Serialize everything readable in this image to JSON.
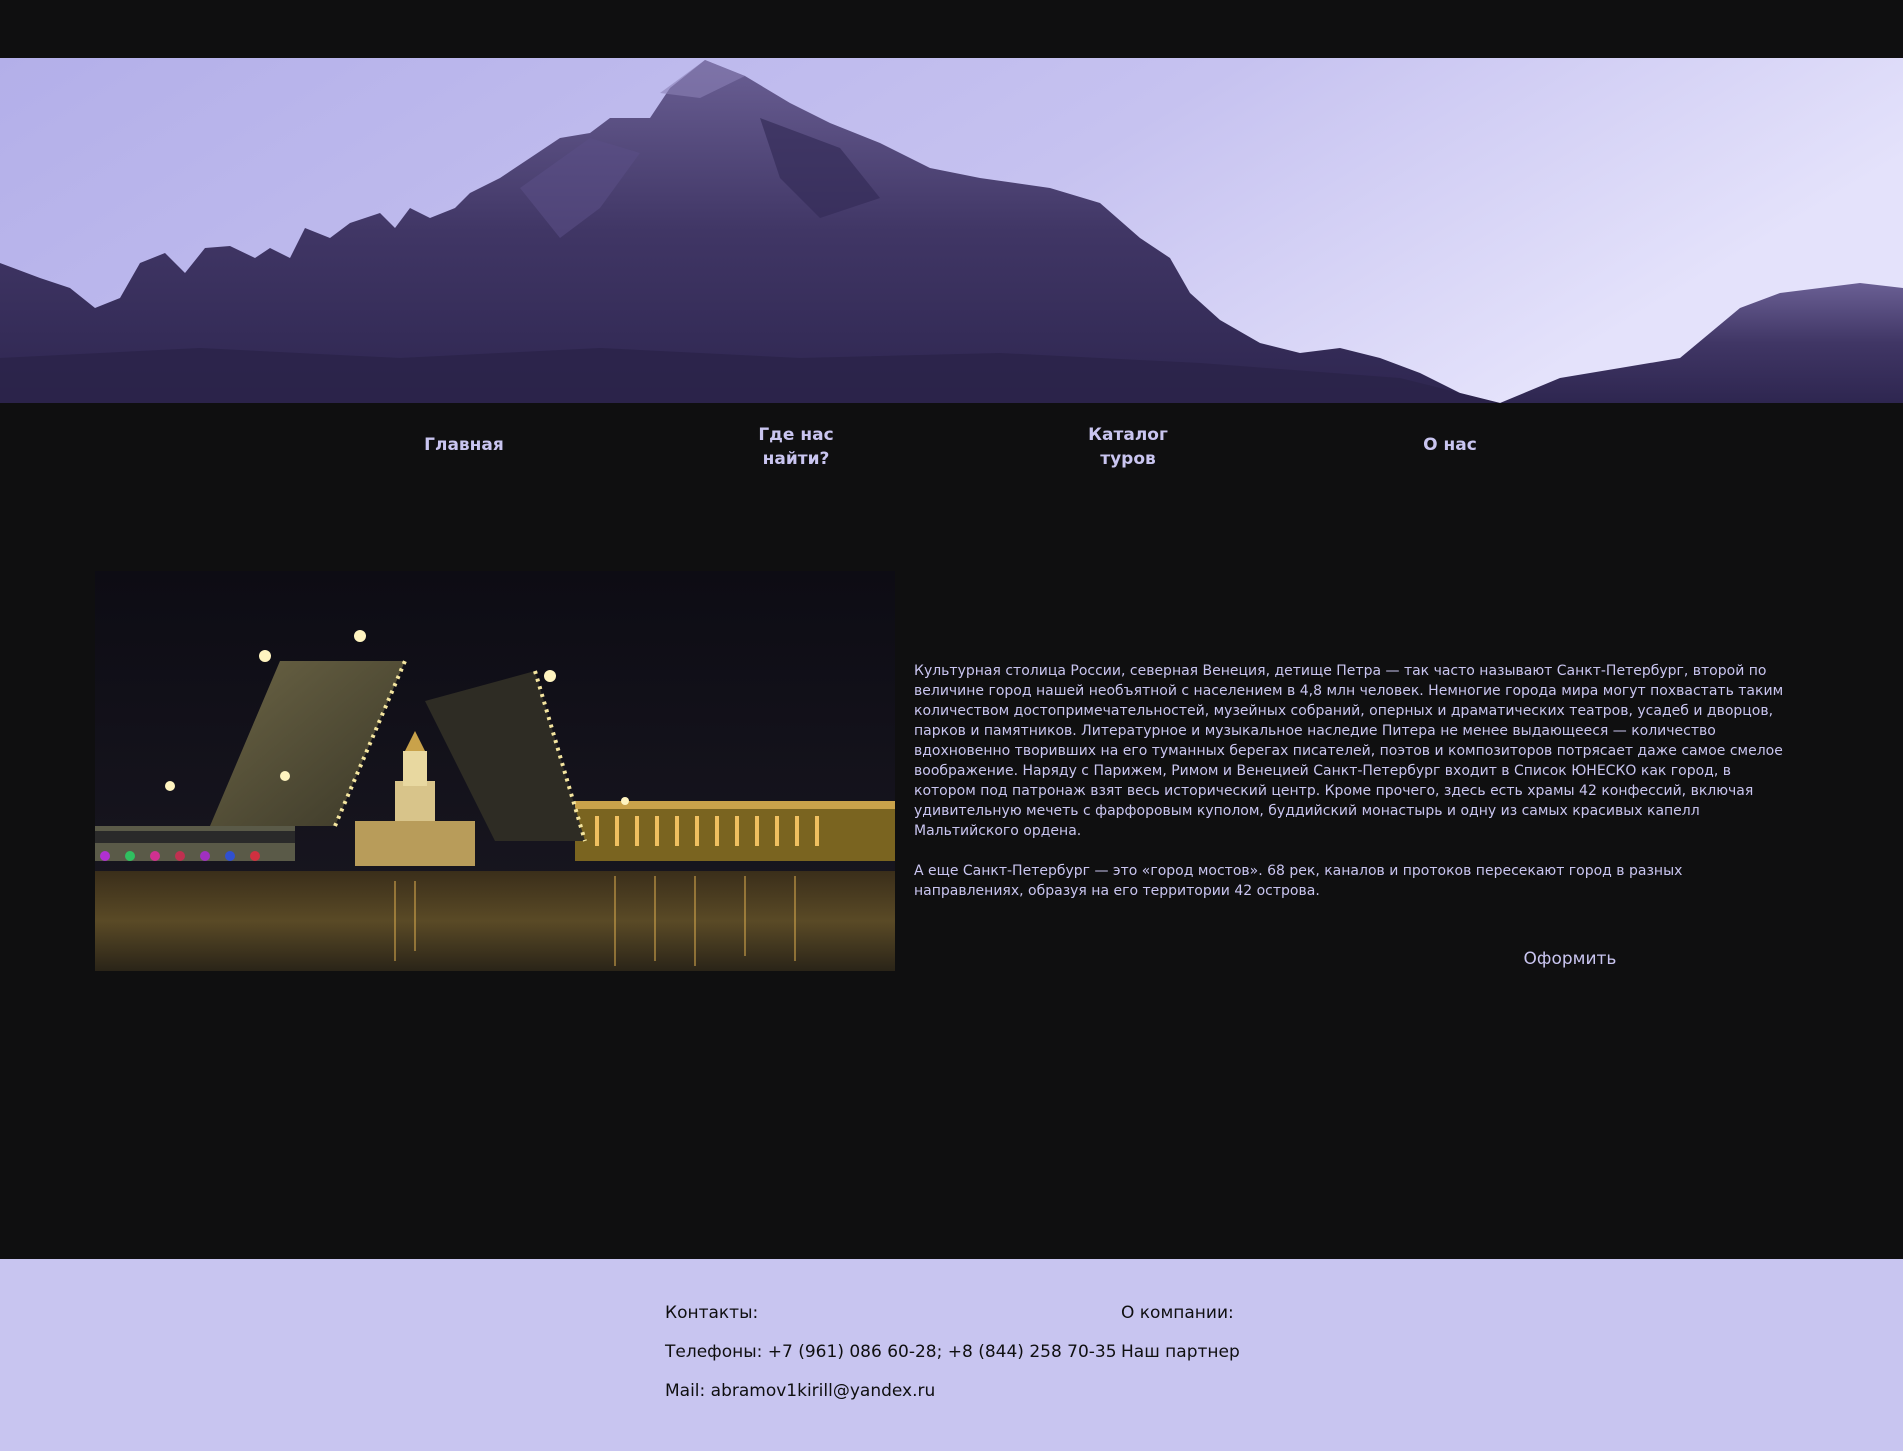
{
  "colors": {
    "background": "#0f0f10",
    "accent": "#c9c5f0",
    "footer_bg": "#c8c5f0",
    "footer_text": "#0f0f10"
  },
  "hero": {
    "image": "mountain-panorama"
  },
  "nav": {
    "items": [
      {
        "label": "Главная"
      },
      {
        "label": "Где нас\nнайти?"
      },
      {
        "label": "Каталог\nтуров"
      },
      {
        "label": "О нас"
      }
    ]
  },
  "main": {
    "image": "night-drawbridge-st-petersburg",
    "paragraphs": [
      "Культурная столица России, северная Венеция, детище Петра — так часто называют Санкт-Петербург, второй по величине город нашей необъятной с населением в 4,8 млн человек. Немногие города мира могут похвастать таким количеством достопримечательностей, музейных собраний, оперных и драматических театров, усадеб и дворцов, парков и памятников. Литературное и музыкальное наследие Питера не менее выдающееся — количество вдохновенно творивших на его туманных берегах писателей, поэтов и композиторов потрясает даже самое смелое воображение. Наряду с Парижем, Римом и Венецией Санкт-Петербург входит в Список ЮНЕСКО как город, в котором под патронаж взят весь исторический центр. Кроме прочего, здесь есть храмы 42 конфессий, включая удивительную мечеть с фарфоровым куполом, буддийский монастырь и одну из самых красивых капелл Мальтийского ордена.",
      "А еще Санкт-Петербург — это «город мостов». 68 рек, каналов и протоков пересекают город в разных направлениях, образуя на его территории 42 острова."
    ],
    "order_button": "Оформить"
  },
  "footer": {
    "contacts_title": "Контакты:",
    "phones": "Телефоны: +7 (961) 086 60-28; +8 (844) 258 70-35",
    "mail": "Mail: abramov1kirill@yandex.ru",
    "company_title": "О компании:",
    "partner_link": "Наш партнер"
  }
}
